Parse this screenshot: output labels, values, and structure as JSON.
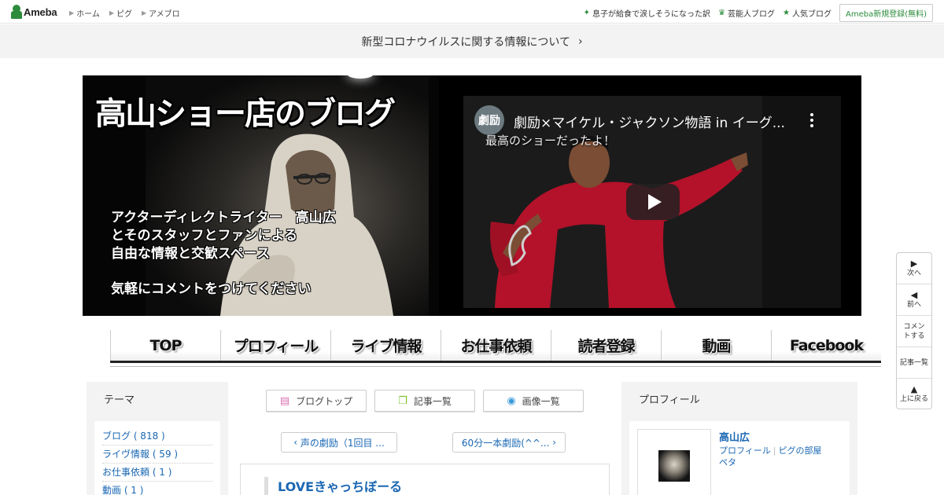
{
  "topbar": {
    "logo_text": "Ameba",
    "nav": [
      "ホーム",
      "ピグ",
      "アメブロ"
    ],
    "links": [
      {
        "icon": "sparkle-icon",
        "label": "息子が給食で涙しそうになった訳"
      },
      {
        "icon": "crown-icon",
        "label": "芸能人ブログ"
      },
      {
        "icon": "star-icon",
        "label": "人気ブログ"
      }
    ],
    "register_label": "Ameba新規登録(無料)"
  },
  "notice": {
    "text": "新型コロナウイルスに関する情報について",
    "arrow": "›"
  },
  "banner": {
    "title": "高山ショー店のブログ",
    "lines": [
      "アクターディレクトライター　高山広",
      "とそのスタッフとファンによる",
      "自由な情報と交歓スペース",
      "気軽にコメントをつけてください"
    ]
  },
  "video": {
    "channel_label": "劇励",
    "title": "劇励×マイケル・ジャクソン物語 in イーグ...",
    "caption": "最高のショーだったよ！"
  },
  "menu": [
    "TOP",
    "プロフィール",
    "ライブ情報",
    "お仕事依頼",
    "読者登録",
    "動画",
    "Facebook"
  ],
  "left_sidebar": {
    "heading": "テーマ",
    "themes": [
      "ブログ ( 818 )",
      "ライヴ情報 ( 59 )",
      "お仕事依頼 ( 1 )",
      "動画 ( 1 )"
    ]
  },
  "toolbar": {
    "blog_top": "ブログトップ",
    "article_list": "記事一覧",
    "image_list": "画像一覧"
  },
  "pager": {
    "prev": "声の劇励（1回目 ...",
    "next": "60分一本劇励(^^..."
  },
  "article": {
    "title": "LOVEきゃっちぼーる"
  },
  "right_sidebar": {
    "heading": "プロフィール",
    "name": "高山広",
    "link_profile": "プロフィール",
    "link_pigg": "ピグの部屋",
    "link_peta": "ペタ"
  },
  "float_nav": {
    "next": "次へ",
    "prev": "前へ",
    "comment": "コメントする",
    "list": "記事一覧",
    "top": "上に戻る"
  },
  "colors": {
    "ameba_green": "#2d8c3c",
    "link_blue": "#1a67b3"
  }
}
